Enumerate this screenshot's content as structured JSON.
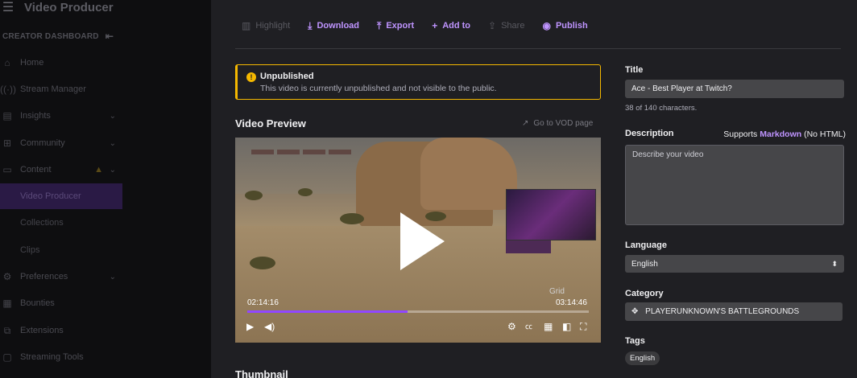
{
  "sidebar": {
    "app_title": "Video Producer",
    "section_header": "CREATOR DASHBOARD",
    "items": [
      {
        "label": "Home",
        "icon": "home-icon"
      },
      {
        "label": "Stream Manager",
        "icon": "broadcast-icon"
      },
      {
        "label": "Insights",
        "icon": "insights-icon"
      },
      {
        "label": "Community",
        "icon": "community-icon"
      },
      {
        "label": "Content",
        "icon": "content-icon"
      },
      {
        "label": "Preferences",
        "icon": "gear-icon"
      },
      {
        "label": "Bounties",
        "icon": "bounties-icon"
      },
      {
        "label": "Extensions",
        "icon": "extensions-icon"
      },
      {
        "label": "Streaming Tools",
        "icon": "tools-icon"
      }
    ],
    "content_sub": [
      "Video Producer",
      "Collections",
      "Clips"
    ]
  },
  "toolbar": {
    "highlight": "Highlight",
    "download": "Download",
    "export": "Export",
    "add_to": "Add to",
    "share": "Share",
    "publish": "Publish"
  },
  "banner": {
    "title": "Unpublished",
    "description": "This video is currently unpublished and not visible to the public."
  },
  "video": {
    "section_title": "Video Preview",
    "vod_link": "Go to VOD page",
    "current_time": "02:14:16",
    "total_time": "03:14:46",
    "progress": 0.47,
    "overlay_text": "Grid"
  },
  "thumbnail": {
    "section_title": "Thumbnail"
  },
  "form": {
    "title_label": "Title",
    "title_value": "Ace - Best Player at Twitch?",
    "title_count": "38 of 140 characters.",
    "description_label": "Description",
    "supports_prefix": "Supports",
    "supports_link": "Markdown",
    "supports_suffix": "(No HTML)",
    "description_placeholder": "Describe your video",
    "language_label": "Language",
    "language_value": "English",
    "category_label": "Category",
    "category_value": "PLAYERUNKNOWN'S BATTLEGROUNDS",
    "tags_label": "Tags",
    "tags": [
      "English"
    ]
  },
  "colors": {
    "accent": "#bf94ff",
    "warning": "#f5b800",
    "background": "#1f1f23",
    "sidebar": "#0e0e10"
  }
}
